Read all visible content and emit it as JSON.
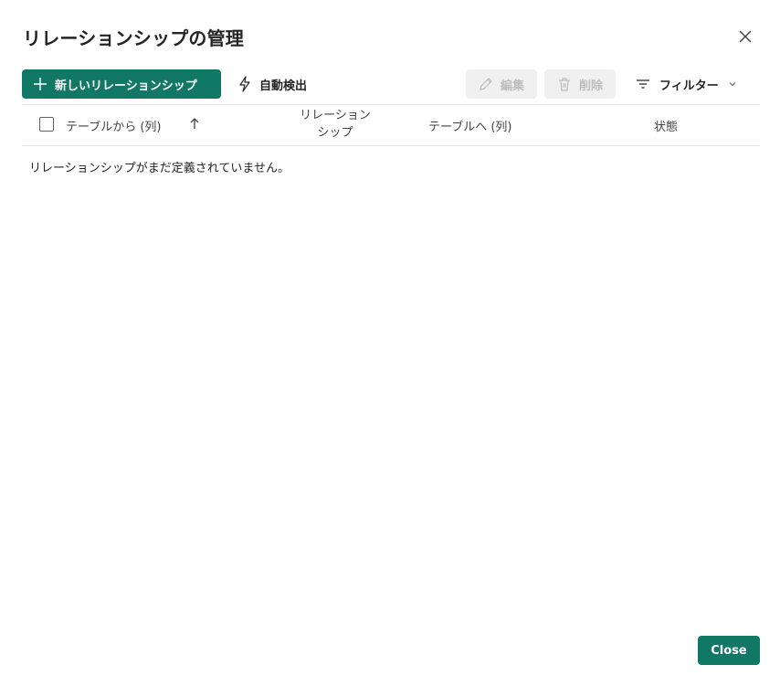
{
  "dialog": {
    "title": "リレーションシップの管理",
    "close_icon": "close-icon"
  },
  "toolbar": {
    "new_label": "新しいリレーションシップ",
    "autodetect_label": "自動検出",
    "edit_label": "編集",
    "delete_label": "削除",
    "filter_label": "フィルター"
  },
  "table": {
    "columns": {
      "from": "テーブルから (列)",
      "relationship_line1": "リレーション",
      "relationship_line2": "シップ",
      "to": "テーブルへ (列)",
      "status": "状態"
    },
    "empty_message": "リレーションシップがまだ定義されていません。"
  },
  "footer": {
    "close_label": "Close"
  },
  "colors": {
    "primary": "#117865",
    "disabled_bg": "#f0f0f0",
    "disabled_text": "#bdbdbd"
  }
}
